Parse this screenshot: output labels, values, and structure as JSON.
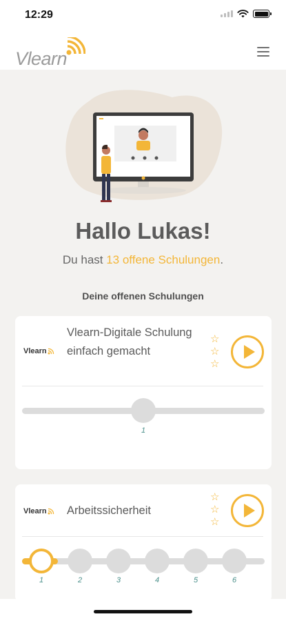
{
  "status_bar": {
    "time": "12:29"
  },
  "header": {
    "logo_text": "Vlearn"
  },
  "greeting": {
    "title": "Hallo Lukas!",
    "prefix": "Du hast ",
    "highlight": "13 offene Schulungen",
    "suffix": "."
  },
  "section_title": "Deine offenen Schulungen",
  "colors": {
    "accent": "#f3b638",
    "track": "#dcdcdc",
    "label": "#4a8f8a"
  },
  "courses": [
    {
      "logo_text": "Vlearn",
      "title": "Vlearn-Digitale Schulung einfach gemacht",
      "stars": [
        "☆",
        "☆",
        "☆"
      ],
      "progress_steps": [
        "1"
      ],
      "current_step": 1,
      "completed_fraction": 0
    },
    {
      "logo_text": "Vlearn",
      "title": "Arbeitssicherheit",
      "stars": [
        "☆",
        "☆",
        "☆"
      ],
      "progress_steps": [
        "1",
        "2",
        "3",
        "4",
        "5",
        "6"
      ],
      "current_step": 1,
      "completed_fraction": 0
    }
  ]
}
